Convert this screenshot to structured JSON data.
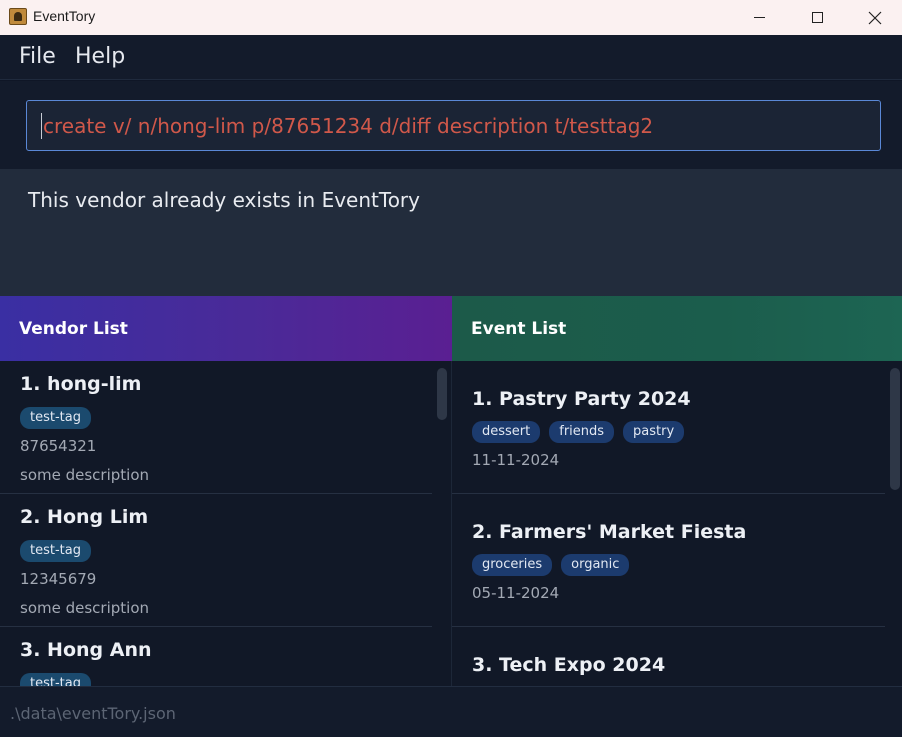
{
  "window": {
    "title": "EventTory",
    "icon": "app-icon",
    "controls": [
      "minimize-icon",
      "maximize-icon",
      "close-icon"
    ]
  },
  "menu": {
    "file": "File",
    "help": "Help"
  },
  "command": {
    "value": "create v/ n/hong-lim p/87651234 d/diff description t/testtag2"
  },
  "result": {
    "message": "This vendor already exists in EventTory"
  },
  "vendor_panel": {
    "title": "Vendor List",
    "vendors": [
      {
        "name": "1. hong-lim",
        "tags": [
          "test-tag"
        ],
        "phone": "87654321",
        "description": "some description"
      },
      {
        "name": "2. Hong Lim",
        "tags": [
          "test-tag"
        ],
        "phone": "12345679",
        "description": "some description"
      },
      {
        "name": "3. Hong Ann",
        "tags": [
          "test-tag"
        ]
      }
    ]
  },
  "event_panel": {
    "title": "Event List",
    "events": [
      {
        "name": "1. Pastry Party 2024",
        "tags": [
          "dessert",
          "friends",
          "pastry"
        ],
        "date": "11-11-2024"
      },
      {
        "name": "2. Farmers' Market Fiesta",
        "tags": [
          "groceries",
          "organic"
        ],
        "date": "05-11-2024"
      },
      {
        "name": "3. Tech Expo 2024"
      }
    ]
  },
  "status": {
    "path": ".\\data\\eventTory.json"
  },
  "colors": {
    "background": "#111827",
    "vendor_header": "#4a2a98",
    "event_header": "#1b5d4c",
    "input_border": "#5a88d6",
    "command_text": "#d0584a",
    "tag": "#1c3b6e"
  }
}
